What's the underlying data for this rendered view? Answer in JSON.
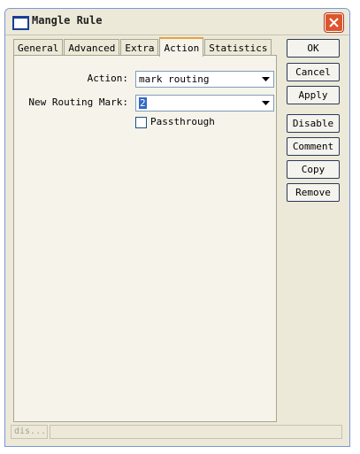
{
  "window": {
    "title": "Mangle Rule"
  },
  "tabs": [
    {
      "label": "General"
    },
    {
      "label": "Advanced"
    },
    {
      "label": "Extra"
    },
    {
      "label": "Action"
    },
    {
      "label": "Statistics"
    }
  ],
  "active_tab": "Action",
  "form": {
    "action_label": "Action:",
    "action_value": "mark routing",
    "routing_mark_label": "New Routing Mark:",
    "routing_mark_value": "2",
    "passthrough_label": "Passthrough",
    "passthrough_checked": false
  },
  "buttons": {
    "ok": "OK",
    "cancel": "Cancel",
    "apply": "Apply",
    "disable": "Disable",
    "comment": "Comment",
    "copy": "Copy",
    "remove": "Remove"
  },
  "status": {
    "text": "dis..."
  },
  "colors": {
    "titlebar_icon": "#1b3e95",
    "close_button": "#e0542c",
    "active_tab_accent": "#e8a33d"
  },
  "icons": {
    "app": "window-icon",
    "close": "close-icon",
    "dropdown": "chevron-down-icon"
  }
}
